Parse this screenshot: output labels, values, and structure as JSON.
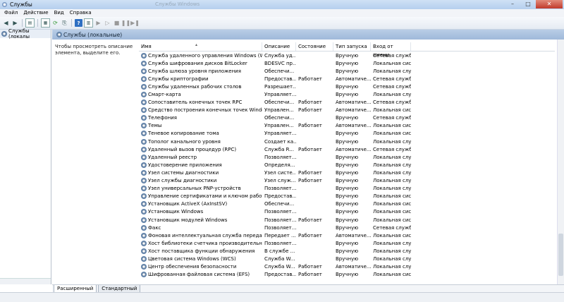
{
  "window": {
    "title": "Службы",
    "ghost_title": "Службы  Windows"
  },
  "menu": [
    "Файл",
    "Действие",
    "Вид",
    "Справка"
  ],
  "tree": {
    "root_label": "Службы (локалы"
  },
  "panel": {
    "header": "Службы (локальные)",
    "description": "Чтобы просмотреть описание элемента, выделите его."
  },
  "columns": [
    "Имя",
    "Описание",
    "Состояние",
    "Тип запуска",
    "Вход от имени"
  ],
  "rows": [
    [
      "Служба удаленного управления Windows (WS-...",
      "Служба уд...",
      "",
      "Вручную",
      "Сетевая служба"
    ],
    [
      "Служба шифрования дисков BitLocker",
      "BDESVC пр...",
      "",
      "Вручную",
      "Локальная сис..."
    ],
    [
      "Служба шлюза уровня приложения",
      "Обеспечи...",
      "",
      "Вручную",
      "Локальная слу..."
    ],
    [
      "Службы криптографии",
      "Предостав...",
      "Работает",
      "Автоматиче...",
      "Сетевая служба"
    ],
    [
      "Службы удаленных рабочих столов",
      "Разрешает...",
      "",
      "Вручную",
      "Сетевая служба"
    ],
    [
      "Смарт-карта",
      "Управляет...",
      "",
      "Вручную",
      "Локальная слу..."
    ],
    [
      "Сопоставитель конечных точек RPC",
      "Обеспечи...",
      "Работает",
      "Автоматиче...",
      "Сетевая служба"
    ],
    [
      "Средство построения конечных точек Windows ...",
      "Управлен...",
      "Работает",
      "Автоматиче...",
      "Локальная сис..."
    ],
    [
      "Телефония",
      "Обеспечи...",
      "",
      "Вручную",
      "Сетевая служба"
    ],
    [
      "Темы",
      "Управлен...",
      "Работает",
      "Автоматиче...",
      "Локальная сис..."
    ],
    [
      "Теневое копирование тома",
      "Управляет...",
      "",
      "Вручную",
      "Локальная сис..."
    ],
    [
      "Тополог канального уровня",
      "Создает ка...",
      "",
      "Вручную",
      "Локальная слу..."
    ],
    [
      "Удаленный вызов процедур (RPC)",
      "Служба R...",
      "Работает",
      "Автоматиче...",
      "Сетевая служба"
    ],
    [
      "Удаленный реестр",
      "Позволяет...",
      "",
      "Вручную",
      "Локальная слу..."
    ],
    [
      "Удостоверение приложения",
      "Определя...",
      "",
      "Вручную",
      "Локальная слу..."
    ],
    [
      "Узел системы диагностики",
      "Узел систе...",
      "Работает",
      "Вручную",
      "Локальная слу..."
    ],
    [
      "Узел службы диагностики",
      "Узел служ...",
      "Работает",
      "Вручную",
      "Локальная слу..."
    ],
    [
      "Узел универсальных PNP-устройств",
      "Позволяет...",
      "",
      "Вручную",
      "Локальная слу..."
    ],
    [
      "Управление сертификатами и ключом работос...",
      "Предостав...",
      "",
      "Вручную",
      "Локальная сис..."
    ],
    [
      "Установщик ActiveX (AxInstSV)",
      "Обеспечи...",
      "",
      "Вручную",
      "Локальная сис..."
    ],
    [
      "Установщик Windows",
      "Позволяет...",
      "",
      "Вручную",
      "Локальная сис..."
    ],
    [
      "Установщик модулей Windows",
      "Позволяет...",
      "Работает",
      "Вручную",
      "Локальная сис..."
    ],
    [
      "Факс",
      "Позволяет...",
      "",
      "Вручную",
      "Сетевая служба"
    ],
    [
      "Фоновая интеллектуальная служба передачи (B...",
      "Передает ...",
      "Работает",
      "Автоматиче...",
      "Локальная сис..."
    ],
    [
      "Хост библиотеки счетчика производительности",
      "Позволяет...",
      "",
      "Вручную",
      "Локальная слу..."
    ],
    [
      "Хост поставщика функции обнаружения",
      "В службе ...",
      "",
      "Вручную",
      "Локальная слу..."
    ],
    [
      "Цветовая система Windows (WCS)",
      "Служба W...",
      "",
      "Вручную",
      "Локальная слу..."
    ],
    [
      "Центр обеспечения безопасности",
      "Служба W...",
      "Работает",
      "Автоматиче...",
      "Локальная слу..."
    ],
    [
      "Шифрованная файловая система (EFS)",
      "Предостав...",
      "Работает",
      "Вручную",
      "Локальная сис..."
    ]
  ],
  "tabs": [
    "Расширенный",
    "Стандартный"
  ]
}
